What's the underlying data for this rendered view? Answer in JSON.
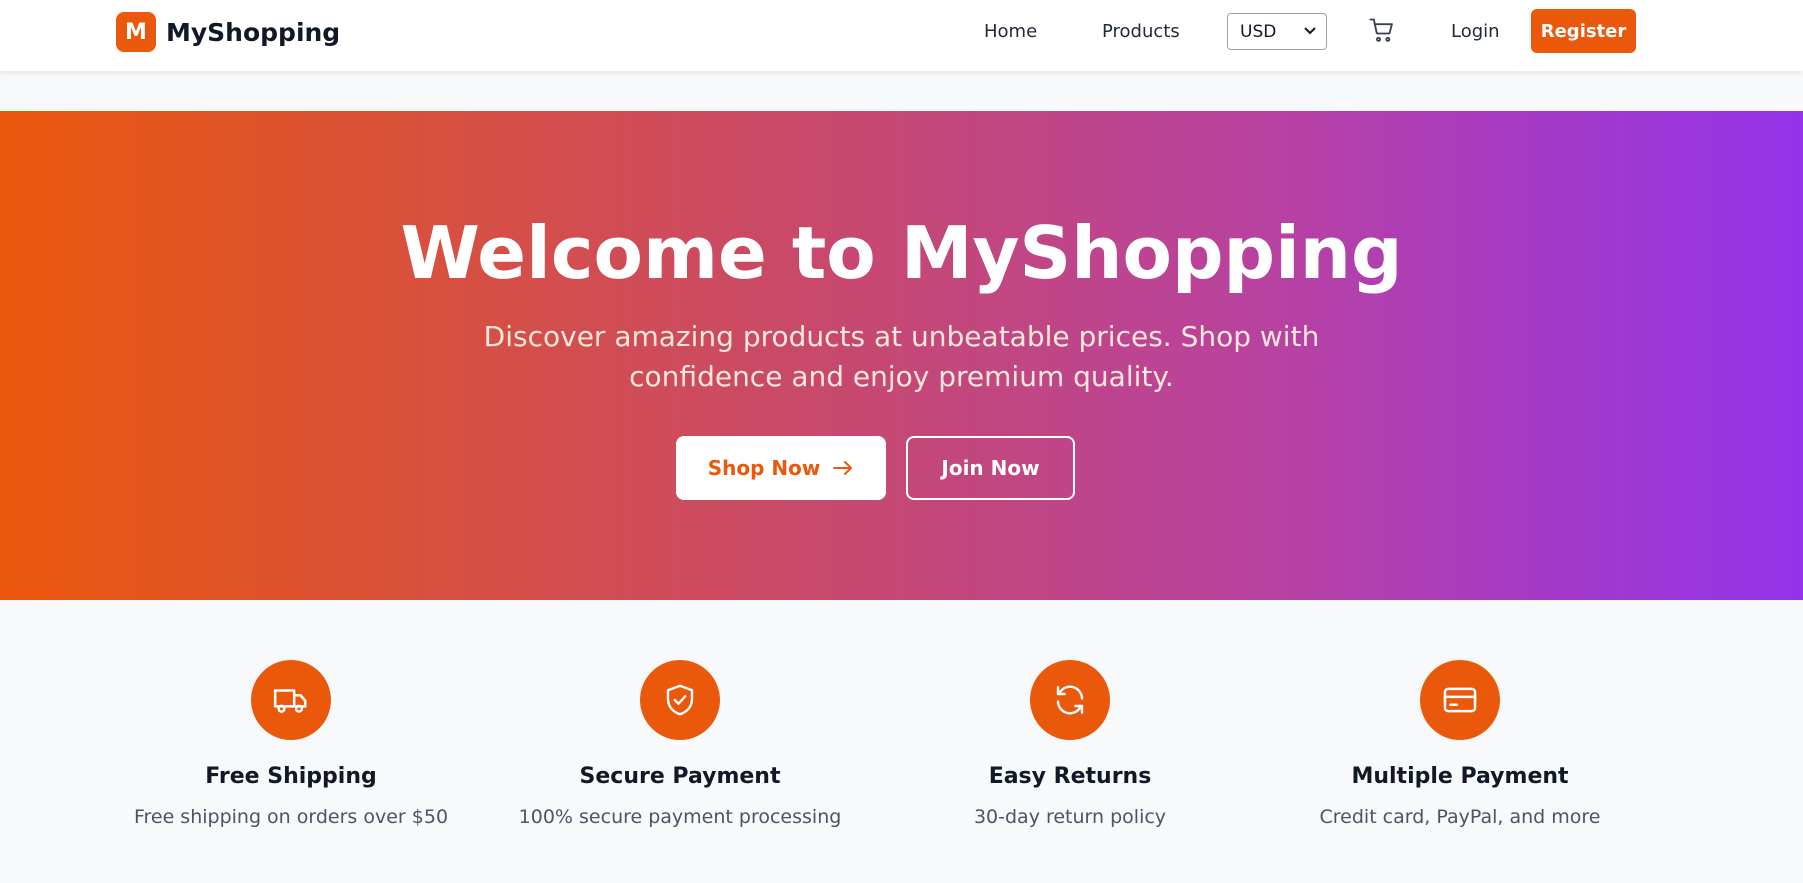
{
  "colors": {
    "accent": "#ea580c",
    "gradient_start": "#ea580c",
    "gradient_end": "#9333ea"
  },
  "header": {
    "logo_letter": "M",
    "brand": "MyShopping",
    "nav": {
      "home": "Home",
      "products": "Products",
      "login": "Login",
      "register": "Register"
    },
    "currency": {
      "selected": "USD"
    },
    "cart_icon": "cart-icon"
  },
  "hero": {
    "title": "Welcome to MyShopping",
    "subtitle": "Discover amazing products at unbeatable prices. Shop with confidence and enjoy premium quality.",
    "primary_button": "Shop Now",
    "secondary_button": "Join Now"
  },
  "features": [
    {
      "icon": "truck-icon",
      "title": "Free Shipping",
      "description": "Free shipping on orders over $50"
    },
    {
      "icon": "shield-check-icon",
      "title": "Secure Payment",
      "description": "100% secure payment processing"
    },
    {
      "icon": "refresh-icon",
      "title": "Easy Returns",
      "description": "30-day return policy"
    },
    {
      "icon": "credit-card-icon",
      "title": "Multiple Payment",
      "description": "Credit card, PayPal, and more"
    }
  ]
}
